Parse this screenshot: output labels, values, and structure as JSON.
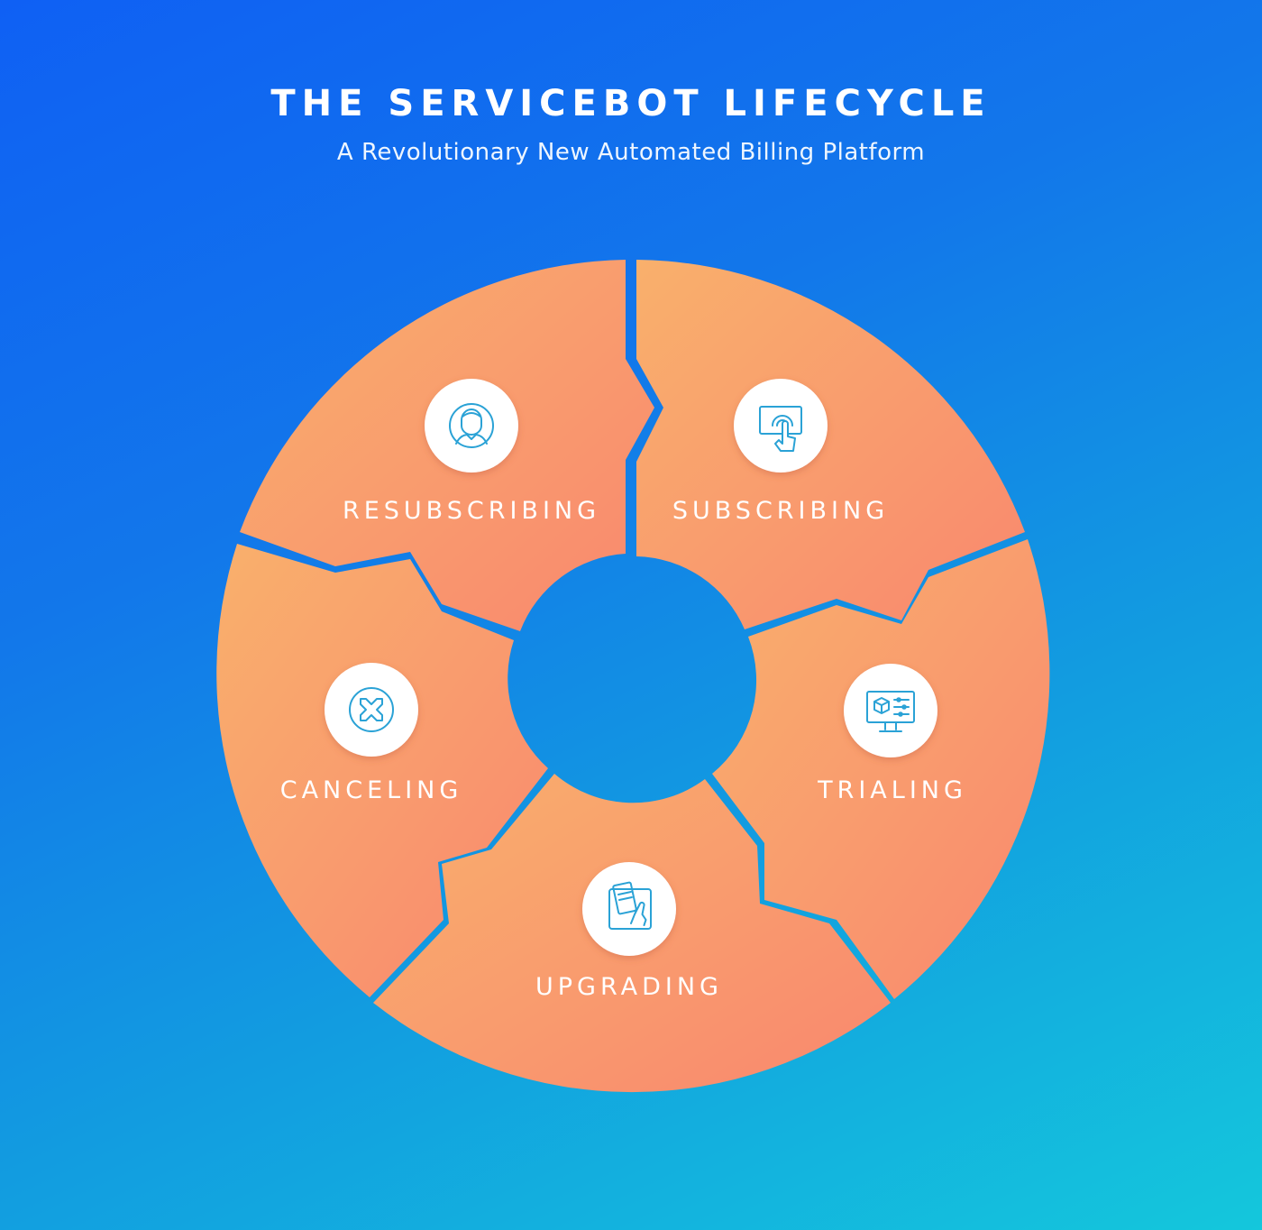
{
  "header": {
    "title": "THE SERVICEBOT LIFECYCLE",
    "subtitle": "A Revolutionary New Automated Billing Platform"
  },
  "colors": {
    "segment_light": "#f9b06c",
    "segment_dark": "#f9876e",
    "icon_stroke": "#2aa2d6",
    "background_top": "#0f60f4",
    "background_bottom": "#14c7dc"
  },
  "segments": [
    {
      "label": "SUBSCRIBING",
      "icon": "touch-screen-icon"
    },
    {
      "label": "TRIALING",
      "icon": "monitor-settings-icon"
    },
    {
      "label": "UPGRADING",
      "icon": "card-payment-icon"
    },
    {
      "label": "CANCELING",
      "icon": "cancel-x-icon"
    },
    {
      "label": "RESUBSCRIBING",
      "icon": "user-avatar-icon"
    }
  ]
}
